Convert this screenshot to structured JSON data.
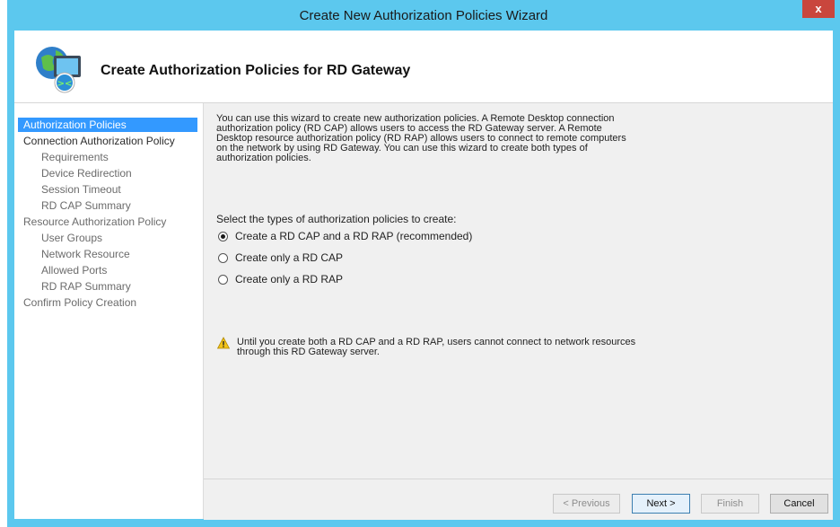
{
  "window": {
    "title": "Create New Authorization Policies Wizard",
    "close_glyph": "x"
  },
  "header": {
    "title": "Create Authorization Policies for RD Gateway",
    "icon": "rd-gateway-icon"
  },
  "nav": {
    "items": [
      {
        "label": "Authorization Policies"
      },
      {
        "label": "Connection Authorization Policy"
      },
      {
        "label": "Requirements"
      },
      {
        "label": "Device Redirection"
      },
      {
        "label": "Session Timeout"
      },
      {
        "label": "RD CAP Summary"
      },
      {
        "label": "Resource Authorization Policy"
      },
      {
        "label": "User Groups"
      },
      {
        "label": "Network Resource"
      },
      {
        "label": "Allowed Ports"
      },
      {
        "label": "RD RAP Summary"
      },
      {
        "label": "Confirm Policy Creation"
      }
    ]
  },
  "content": {
    "description_lines": [
      "You can use this wizard to create new authorization policies. A Remote Desktop connection",
      "authorization policy (RD CAP) allows users to access the RD Gateway server. A Remote",
      "Desktop resource authorization policy (RD RAP) allows users to connect to remote computers",
      "on the network by using RD Gateway. You can use this wizard to create both types of",
      "authorization policies."
    ],
    "prompt": "Select the types of authorization policies to create:",
    "options": [
      {
        "label": "Create a RD CAP and a RD RAP (recommended)",
        "selected": true
      },
      {
        "label": "Create only a RD CAP",
        "selected": false
      },
      {
        "label": "Create only a RD RAP",
        "selected": false
      }
    ],
    "warning_lines": [
      "Until you create both a RD CAP and a RD RAP, users cannot connect to network resources",
      "through this RD Gateway server."
    ]
  },
  "buttons": {
    "previous": "< Previous",
    "next": "Next >",
    "finish": "Finish",
    "cancel": "Cancel"
  },
  "colors": {
    "titlebar": "#5cc8ee",
    "close": "#c9463d",
    "selection": "#3399ff"
  }
}
